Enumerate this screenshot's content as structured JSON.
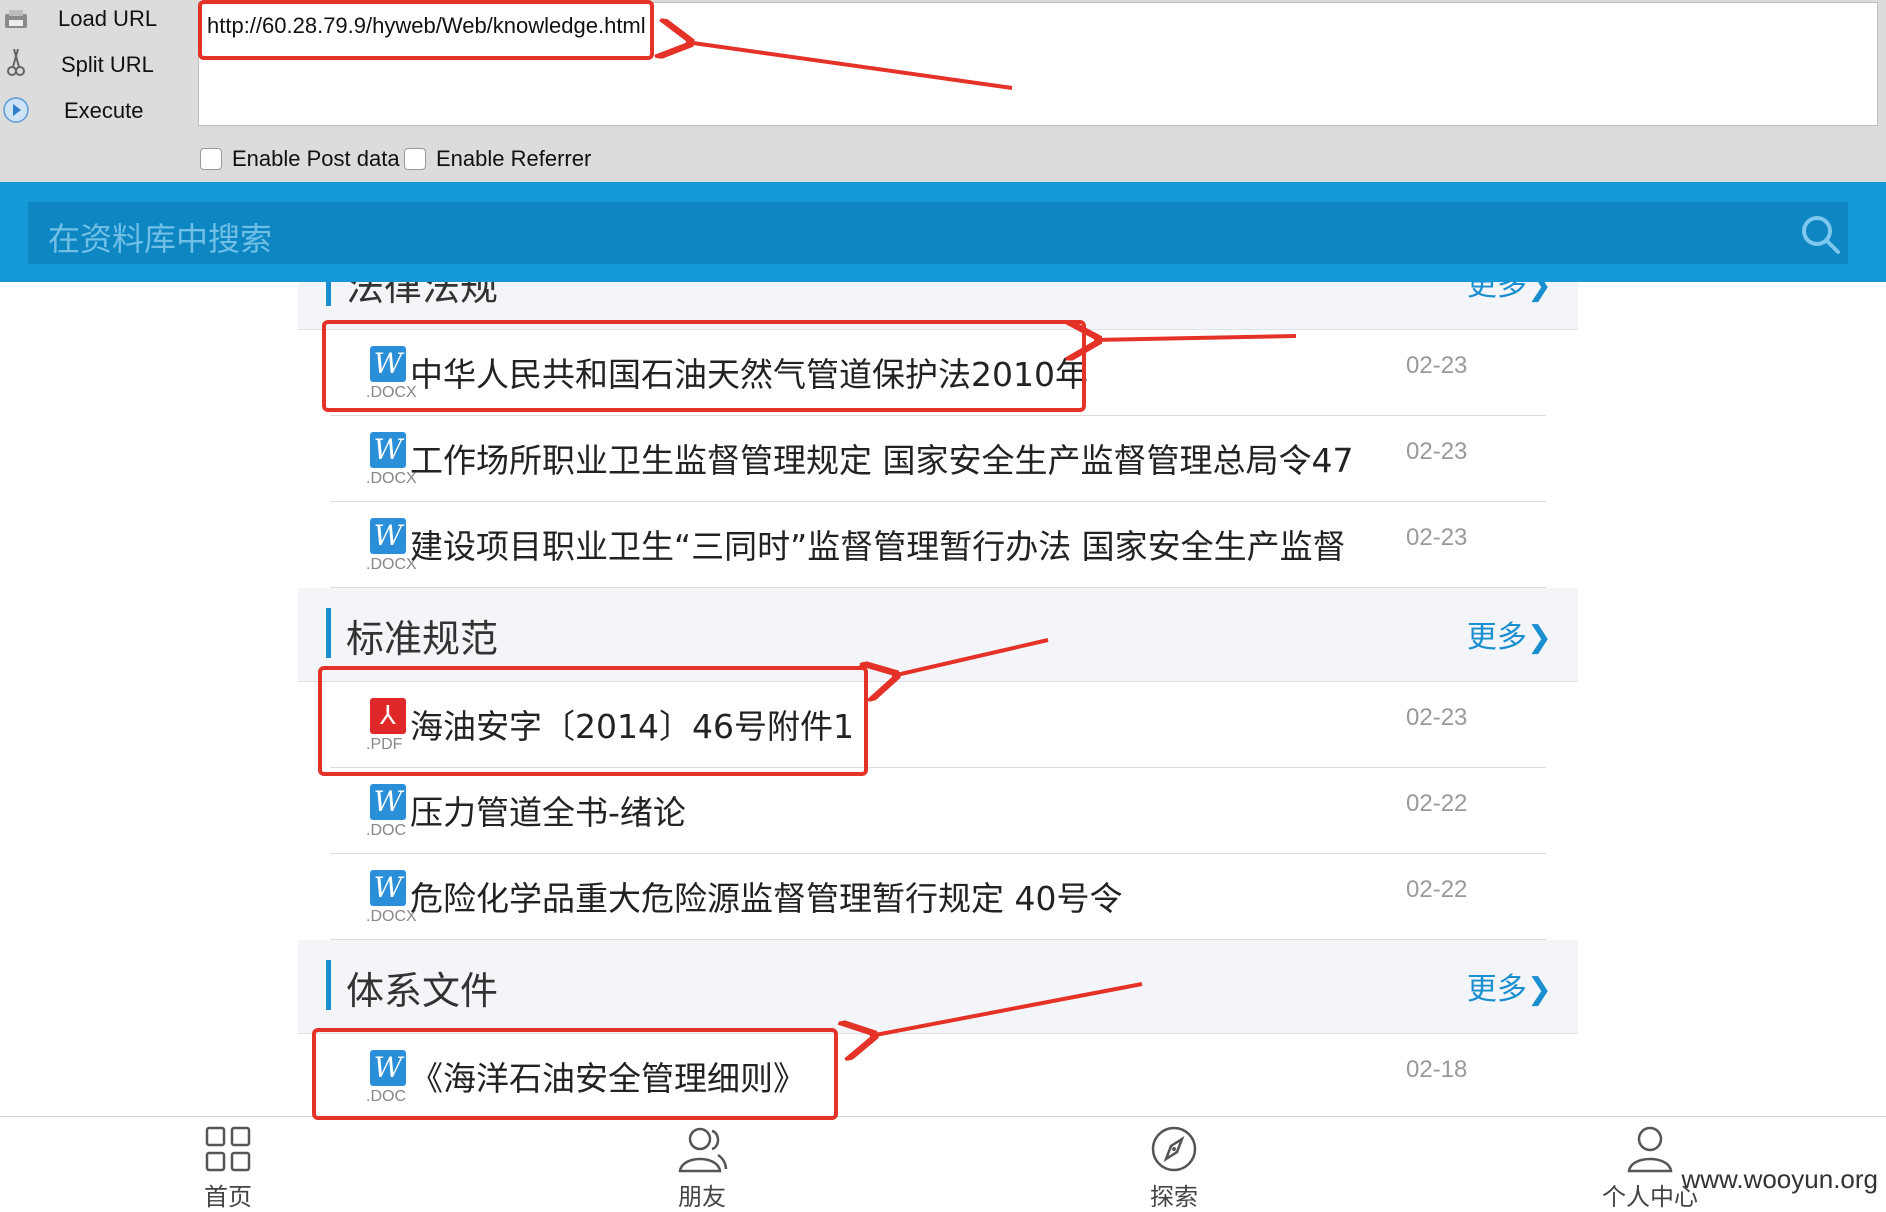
{
  "hackbar": {
    "load_url_label": "Load URL",
    "split_url_label": "Split URL",
    "execute_label": "Execute",
    "url_value": "http://60.28.79.9/hyweb/Web/knowledge.html",
    "enable_post_label": "Enable Post data",
    "enable_referrer_label": "Enable Referrer"
  },
  "search": {
    "placeholder": "在资料库中搜索"
  },
  "sections": [
    {
      "title": "法律法规",
      "more": "更多",
      "items": [
        {
          "type": "word",
          "ext": ".DOCX",
          "title": "中华人民共和国石油天然气管道保护法2010年",
          "date": "02-23"
        },
        {
          "type": "word",
          "ext": ".DOCX",
          "title": "工作场所职业卫生监督管理规定 国家安全生产监督管理总局令47",
          "date": "02-23"
        },
        {
          "type": "word",
          "ext": ".DOCX",
          "title": "建设项目职业卫生“三同时”监督管理暂行办法 国家安全生产监督",
          "date": "02-23"
        }
      ]
    },
    {
      "title": "标准规范",
      "more": "更多",
      "items": [
        {
          "type": "pdf",
          "ext": ".PDF",
          "title": "海油安字〔2014〕46号附件1",
          "date": "02-23"
        },
        {
          "type": "word",
          "ext": ".DOC",
          "title": "压力管道全书-绪论",
          "date": "02-22"
        },
        {
          "type": "word",
          "ext": ".DOCX",
          "title": "危险化学品重大危险源监督管理暂行规定 40号令",
          "date": "02-22"
        }
      ]
    },
    {
      "title": "体系文件",
      "more": "更多",
      "items": [
        {
          "type": "word",
          "ext": ".DOC",
          "title": "《海洋石油安全管理细则》",
          "date": "02-18"
        }
      ]
    }
  ],
  "tabs": [
    {
      "label": "首页",
      "icon": "grid-icon"
    },
    {
      "label": "朋友",
      "icon": "friends-icon"
    },
    {
      "label": "探索",
      "icon": "compass-icon"
    },
    {
      "label": "个人中心",
      "icon": "user-icon"
    }
  ],
  "watermark": "www.wooyun.org",
  "colors": {
    "accent": "#1498d6",
    "annotation": "#e53228",
    "word": "#2a8fd8",
    "pdf": "#e02828"
  }
}
